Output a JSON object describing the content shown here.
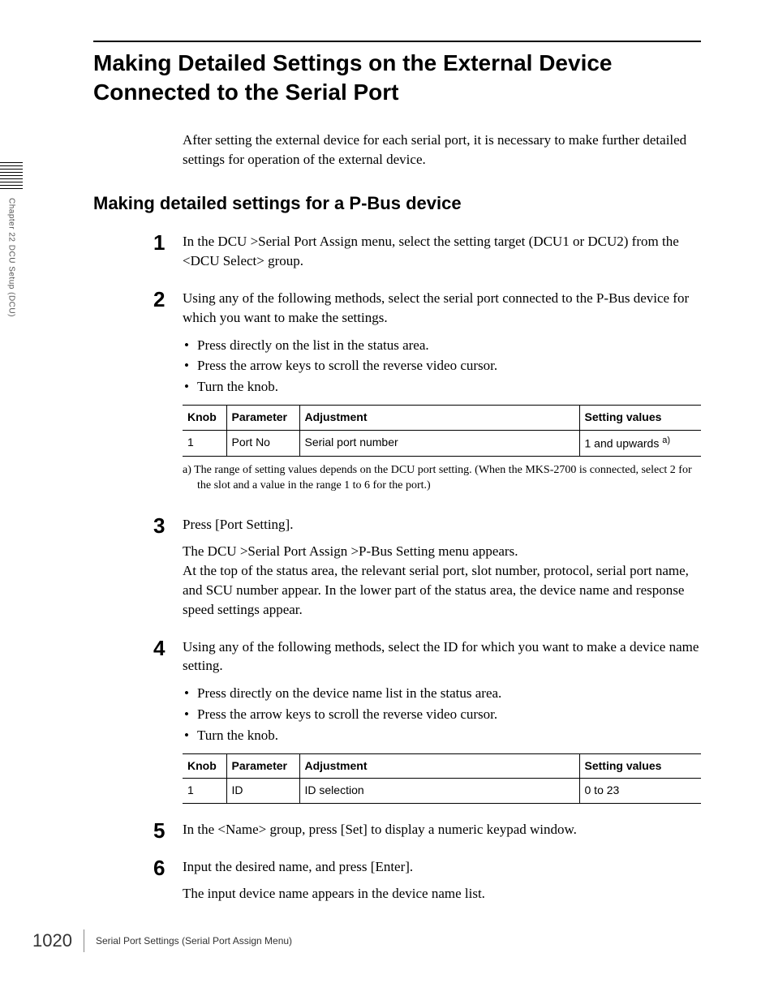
{
  "title": "Making Detailed Settings on the External Device Connected to the Serial Port",
  "intro": "After setting the external device for each serial port, it is necessary to make further detailed settings for operation of the external device.",
  "section_heading": "Making detailed settings for a P-Bus device",
  "sidebar": "Chapter 22  DCU Setup (DCU)",
  "steps": {
    "s1": {
      "num": "1",
      "text": "In the DCU >Serial Port Assign menu, select the setting target (DCU1 or DCU2) from the <DCU Select> group."
    },
    "s2": {
      "num": "2",
      "text": "Using any of the following methods, select the serial port connected to the P-Bus device for which you want to make the settings.",
      "bullets": [
        "Press directly on the list in the status area.",
        "Press the arrow keys to scroll the reverse video cursor.",
        "Turn the knob."
      ],
      "table": {
        "headers": {
          "knob": "Knob",
          "param": "Parameter",
          "adjust": "Adjustment",
          "setting": "Setting values"
        },
        "row1": {
          "knob": "1",
          "param": "Port No",
          "adjust": "Serial port number",
          "setting_prefix": "1 and upwards ",
          "setting_sup": "a)"
        }
      },
      "footnote": "a) The range of setting values depends on the DCU port setting. (When the MKS-2700 is connected, select 2 for the slot and a value in the range 1 to 6 for the port.)"
    },
    "s3": {
      "num": "3",
      "text1": "Press [Port Setting].",
      "text2": "The DCU >Serial Port Assign >P-Bus Setting menu appears.",
      "text3": "At the top of the status area, the relevant serial port, slot number, protocol, serial port name, and SCU number appear. In the lower part of the status area, the device name and response speed settings appear."
    },
    "s4": {
      "num": "4",
      "text": "Using any of the following methods, select the ID for which you want to make a device name setting.",
      "bullets": [
        "Press directly on the device name list in the status area.",
        "Press the arrow keys to scroll the reverse video cursor.",
        "Turn the knob."
      ],
      "table": {
        "headers": {
          "knob": "Knob",
          "param": "Parameter",
          "adjust": "Adjustment",
          "setting": "Setting values"
        },
        "row1": {
          "knob": "1",
          "param": "ID",
          "adjust": "ID selection",
          "setting": "0 to 23"
        }
      }
    },
    "s5": {
      "num": "5",
      "text": "In the <Name> group, press [Set] to display a numeric keypad window."
    },
    "s6": {
      "num": "6",
      "text1": "Input the desired name, and press [Enter].",
      "text2": "The input device name appears in the device name list."
    }
  },
  "footer": {
    "page": "1020",
    "label": "Serial Port Settings (Serial Port Assign Menu)"
  }
}
